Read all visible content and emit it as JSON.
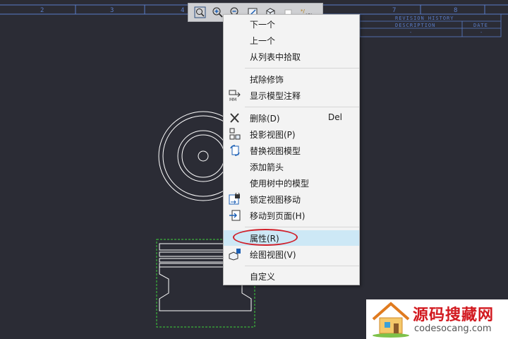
{
  "border_zones": [
    "2",
    "3",
    "4",
    "7",
    "8"
  ],
  "revision_table": {
    "title": "REVISION HISTORY",
    "col_description": "DESCRIPTION",
    "col_date": "DATE",
    "dash1": "-",
    "dash2": "-"
  },
  "toolbar": {
    "buttons": [
      {
        "icon": "zoom-fit-icon"
      },
      {
        "icon": "zoom-in-icon"
      },
      {
        "icon": "zoom-out-icon"
      },
      {
        "icon": "repaint-icon"
      },
      {
        "icon": "display-style-icon"
      },
      {
        "icon": "saved-orientations-icon"
      },
      {
        "icon": "annotation-display-icon"
      }
    ]
  },
  "context_menu": {
    "items": [
      {
        "label": "下一个"
      },
      {
        "label": "上一个"
      },
      {
        "label": "从列表中拾取"
      },
      {
        "label": "拭除修饰"
      },
      {
        "label": "显示模型注释",
        "icon": "show-model-annotations-icon"
      },
      {
        "label": "删除(D)",
        "shortcut": "Del",
        "icon": "delete-icon"
      },
      {
        "label": "投影视图(P)",
        "icon": "projection-view-icon"
      },
      {
        "label": "替换视图模型",
        "icon": "replace-view-model-icon"
      },
      {
        "label": "添加箭头"
      },
      {
        "label": "使用树中的模型"
      },
      {
        "label": "锁定视图移动",
        "icon": "lock-view-icon"
      },
      {
        "label": "移动到页面(H)",
        "icon": "move-to-sheet-icon"
      },
      {
        "label": "属性(R)",
        "highlighted": true
      },
      {
        "label": "绘图视图(V)",
        "icon": "drawing-view-icon"
      },
      {
        "label": "自定义"
      }
    ]
  },
  "watermark": {
    "title": "源码搜藏网",
    "url": "codesocang.com"
  },
  "colors": {
    "background": "#2b2c35",
    "drawing_lines": "#ffffff",
    "selection_box": "#3cd23c",
    "highlight_ellipse": "#d0202a",
    "menu_highlight": "#cde8f6"
  }
}
